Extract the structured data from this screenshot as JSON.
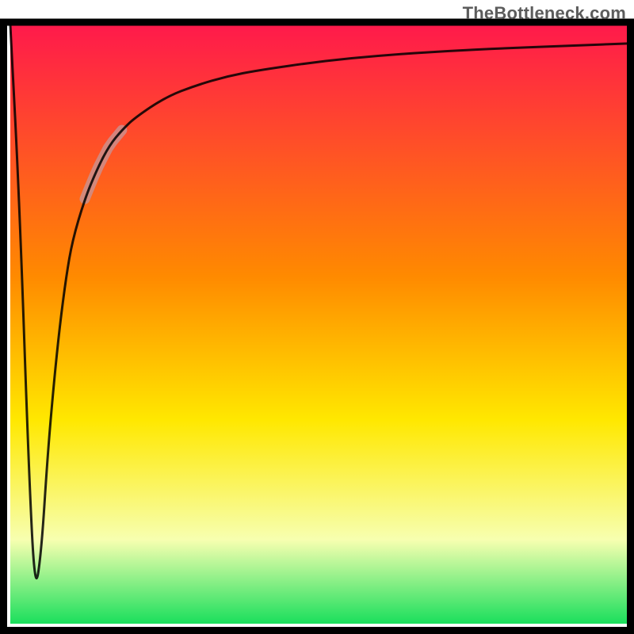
{
  "watermark": "TheBottleneck.com",
  "chart_data": {
    "type": "line",
    "title": "",
    "xlabel": "",
    "ylabel": "",
    "xlim": [
      0,
      100
    ],
    "ylim": [
      0,
      100
    ],
    "grid": false,
    "legend": null,
    "annotations": [],
    "series": [
      {
        "name": "bottleneck-curve",
        "x": [
          0,
          1.5,
          3,
          4,
          5,
          6,
          7,
          8,
          9,
          10,
          12,
          14,
          16,
          18,
          20,
          25,
          30,
          35,
          40,
          50,
          60,
          70,
          80,
          90,
          100
        ],
        "y": [
          100,
          70,
          25,
          5,
          12,
          28,
          40,
          50,
          58,
          64,
          71,
          76,
          80,
          82.5,
          84.5,
          88,
          90,
          91.5,
          92.5,
          94,
          95,
          95.7,
          96.2,
          96.6,
          97
        ],
        "stroke": "#000000",
        "stroke_alpha": 0.85,
        "stroke_width": 3
      }
    ],
    "highlight_segment": {
      "on_series": "bottleneck-curve",
      "x_start": 12,
      "x_end": 18,
      "stroke": "#c99292",
      "stroke_alpha": 0.8,
      "stroke_width": 13
    },
    "background_gradient": {
      "top": "#ff1a4b",
      "mid1": "#ff8a00",
      "mid2": "#ffe800",
      "mid3": "#f7ffb0",
      "bottom": "#1adf5c"
    },
    "axes_box": {
      "stroke": "#000000",
      "stroke_width": 9
    }
  }
}
